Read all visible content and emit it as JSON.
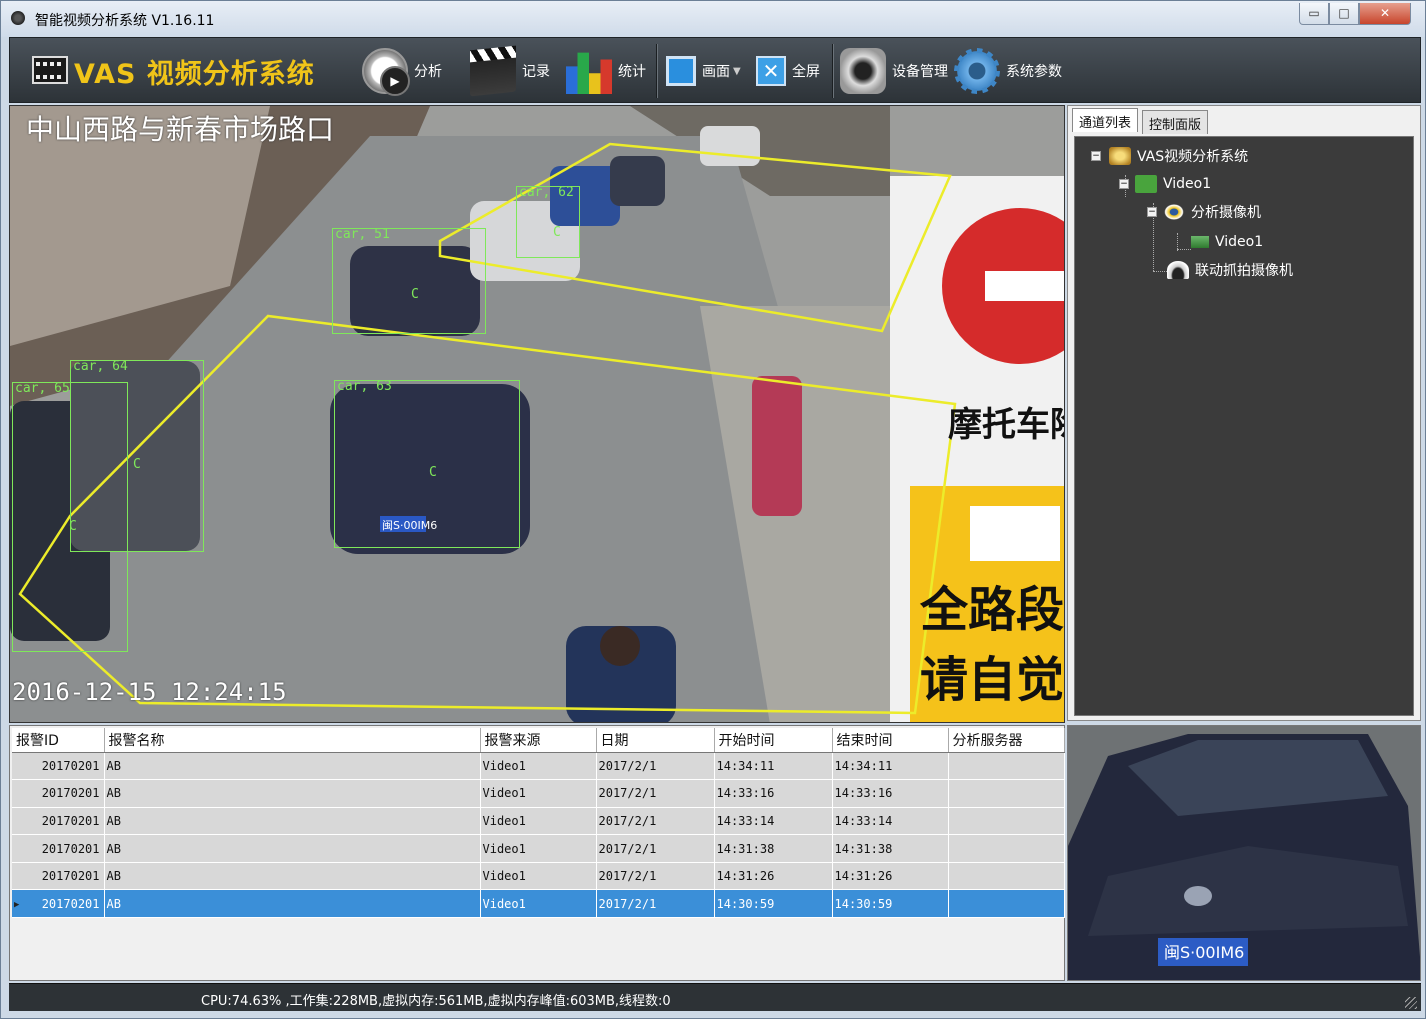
{
  "window": {
    "title": "智能视频分析系统 V1.16.11",
    "min_label": "▭",
    "max_label": "□",
    "close_label": "✕"
  },
  "toolbar": {
    "app_name": "VAS 视频分析系统",
    "tools": [
      {
        "label": "分析",
        "icon": "analyze-icon"
      },
      {
        "label": "记录",
        "icon": "clapperboard-icon"
      },
      {
        "label": "统计",
        "icon": "bar-chart-icon"
      },
      {
        "label": "画面",
        "icon": "screen-layout-icon",
        "has_dropdown": true
      },
      {
        "label": "全屏",
        "icon": "fullscreen-icon"
      },
      {
        "label": "设备管理",
        "icon": "camera-device-icon"
      },
      {
        "label": "系统参数",
        "icon": "gear-icon"
      }
    ]
  },
  "video": {
    "caption": "中山西路与新春市场路口",
    "timestamp": "2016-12-15  12:24:15",
    "detections": [
      {
        "label": "car, 51",
        "c": "C"
      },
      {
        "label": "car, 62",
        "c": "C"
      },
      {
        "label": "car, 64",
        "c": "C"
      },
      {
        "label": "car, 63",
        "c": "C"
      },
      {
        "label": "car, 65",
        "c": "C"
      }
    ],
    "sign_text_1": "摩托车除",
    "sign_text_2": "全路段监",
    "sign_text_3": "请自觉遵",
    "plate": "闽S·00IM6"
  },
  "tree": {
    "tabs": [
      "通道列表",
      "控制面版"
    ],
    "nodes": {
      "root": "VAS视频分析系统",
      "video": "Video1",
      "analysis_camera": "分析摄像机",
      "analysis_video": "Video1",
      "linked_camera": "联动抓拍摄像机"
    }
  },
  "alarms": {
    "columns": [
      "报警ID",
      "报警名称",
      "报警来源",
      "日期",
      "开始时间",
      "结束时间",
      "分析服务器"
    ],
    "rows": [
      {
        "id": "20170201",
        "name": "AB",
        "source": "Video1",
        "date": "2017/2/1",
        "start": "14:34:11",
        "end": "14:34:11",
        "server": ""
      },
      {
        "id": "20170201",
        "name": "AB",
        "source": "Video1",
        "date": "2017/2/1",
        "start": "14:33:16",
        "end": "14:33:16",
        "server": ""
      },
      {
        "id": "20170201",
        "name": "AB",
        "source": "Video1",
        "date": "2017/2/1",
        "start": "14:33:14",
        "end": "14:33:14",
        "server": ""
      },
      {
        "id": "20170201",
        "name": "AB",
        "source": "Video1",
        "date": "2017/2/1",
        "start": "14:31:38",
        "end": "14:31:38",
        "server": ""
      },
      {
        "id": "20170201",
        "name": "AB",
        "source": "Video1",
        "date": "2017/2/1",
        "start": "14:31:26",
        "end": "14:31:26",
        "server": ""
      },
      {
        "id": "20170201",
        "name": "AB",
        "source": "Video1",
        "date": "2017/2/1",
        "start": "14:30:59",
        "end": "14:30:59",
        "server": "",
        "selected": true
      }
    ]
  },
  "status": {
    "text": "CPU:74.63% ,工作集:228MB,虚拟内存:561MB,虚拟内存峰值:603MB,线程数:0"
  }
}
